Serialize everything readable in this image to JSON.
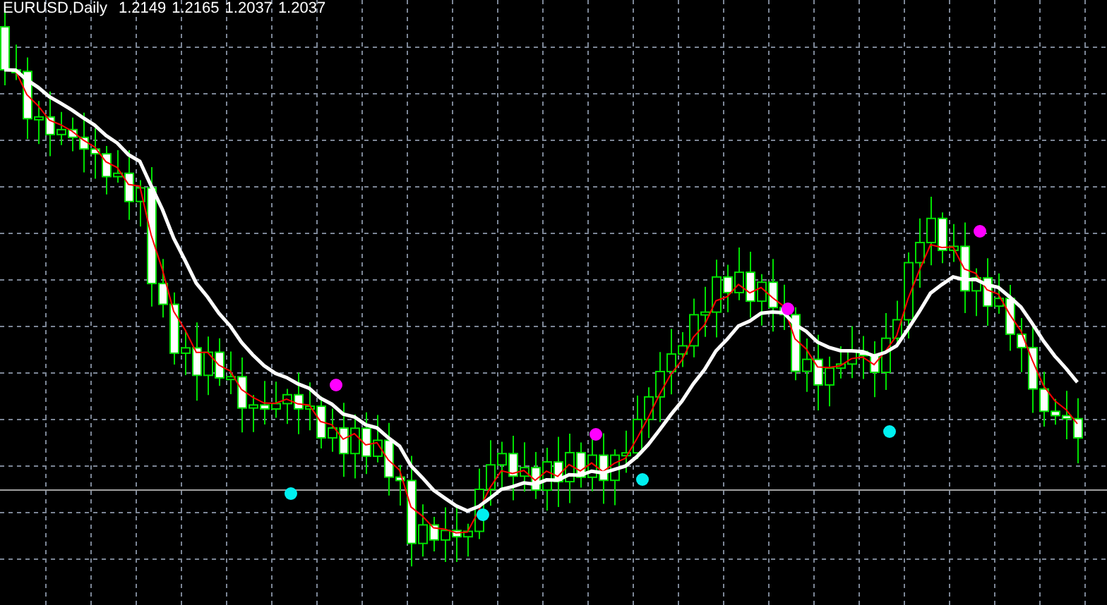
{
  "chart": {
    "title": "EURUSD,Daily",
    "ohlc": [
      "1.2149",
      "1.2165",
      "1.2037",
      "1.2037"
    ]
  }
}
